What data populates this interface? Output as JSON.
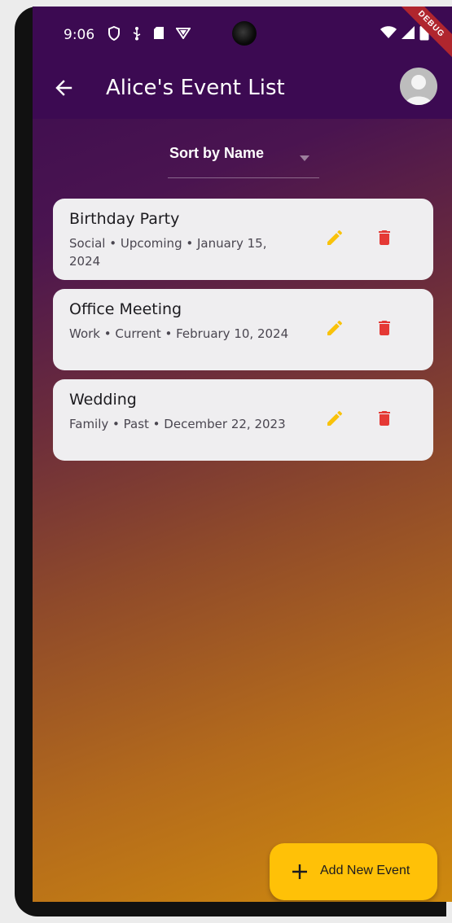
{
  "status_bar": {
    "time": "9:06",
    "icons_left": [
      "shield-icon",
      "usb-icon",
      "sd-card-icon",
      "vpn-icon"
    ],
    "icons_right": [
      "wifi-icon",
      "signal-icon",
      "battery-icon"
    ],
    "debug_banner": "DEBUG"
  },
  "app_bar": {
    "title": "Alice's Event List",
    "back_icon": "arrow-left-icon",
    "avatar_icon": "person-icon",
    "background": "#3c0a52"
  },
  "sort": {
    "label": "Sort by Name"
  },
  "events": [
    {
      "title": "Birthday Party",
      "subtitle": "Social • Upcoming • January 15, 2024"
    },
    {
      "title": "Office Meeting",
      "subtitle": "Work • Current • February 10, 2024"
    },
    {
      "title": "Wedding",
      "subtitle": "Family • Past • December 22, 2023"
    }
  ],
  "fab": {
    "label": "Add New Event",
    "icon": "plus-icon",
    "color": "#ffc107"
  },
  "colors": {
    "edit": "#f9c20a",
    "delete": "#e53935",
    "card": "#efeef0"
  }
}
